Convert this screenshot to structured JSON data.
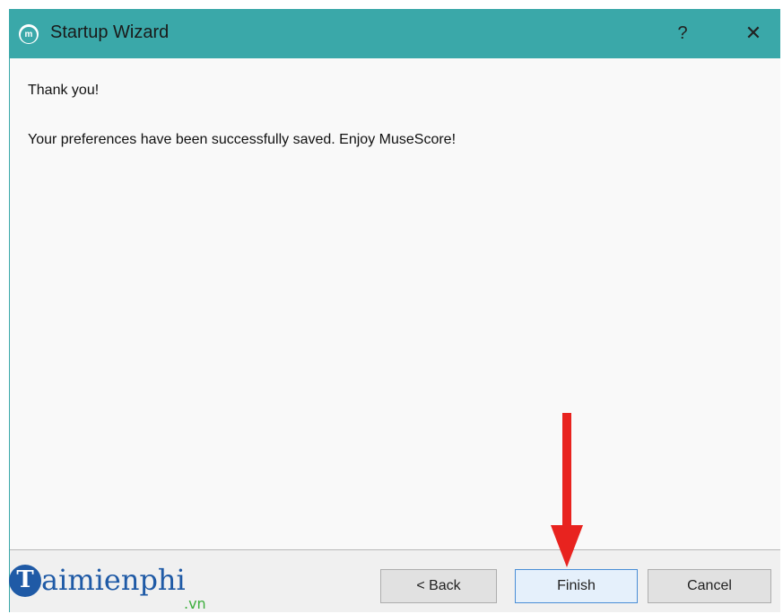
{
  "window": {
    "title": "Startup Wizard",
    "app_icon_text": "m",
    "help_label": "?",
    "close_label": "✕"
  },
  "content": {
    "heading": "Thank you!",
    "message": "Your preferences have been successfully saved. Enjoy MuseScore!"
  },
  "footer": {
    "back_label": "< Back",
    "finish_label": "Finish",
    "cancel_label": "Cancel"
  },
  "watermark": {
    "letter": "T",
    "text": "aimienphi",
    "suffix": ".vn"
  },
  "colors": {
    "titlebar": "#3aa8a9",
    "arrow": "#e8231f",
    "watermark_blue": "#1f5aa6",
    "watermark_green": "#3cae3c"
  },
  "icons": {
    "app": "musescore-icon",
    "help": "help-icon",
    "close": "close-icon",
    "annotation": "arrow-down-icon"
  }
}
